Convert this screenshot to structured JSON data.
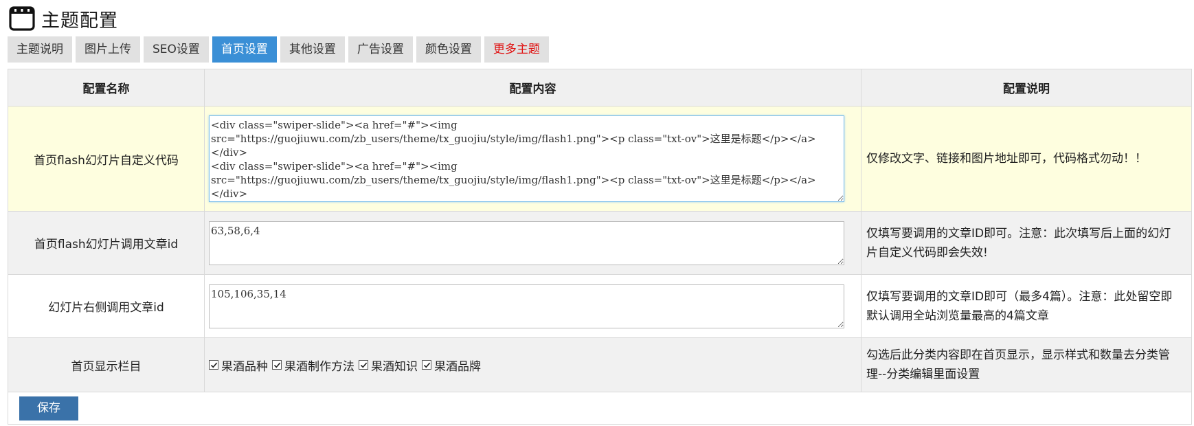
{
  "header": {
    "title": "主题配置",
    "icon": "app-window-icon"
  },
  "tabs": [
    {
      "label": "主题说明",
      "active": false,
      "highlight": false
    },
    {
      "label": "图片上传",
      "active": false,
      "highlight": false
    },
    {
      "label": "SEO设置",
      "active": false,
      "highlight": false
    },
    {
      "label": "首页设置",
      "active": true,
      "highlight": false
    },
    {
      "label": "其他设置",
      "active": false,
      "highlight": false
    },
    {
      "label": "广告设置",
      "active": false,
      "highlight": false
    },
    {
      "label": "颜色设置",
      "active": false,
      "highlight": false
    },
    {
      "label": "更多主题",
      "active": false,
      "highlight": true
    }
  ],
  "table": {
    "columns": [
      "配置名称",
      "配置内容",
      "配置说明"
    ],
    "rows": [
      {
        "name": "首页flash幻灯片自定义代码",
        "value": "<div class=\"swiper-slide\"><a href=\"#\"><img src=\"https://guojiuwu.com/zb_users/theme/tx_guojiu/style/img/flash1.png\"><p class=\"txt-ov\">这里是标题</p></a></div>\n<div class=\"swiper-slide\"><a href=\"#\"><img src=\"https://guojiuwu.com/zb_users/theme/tx_guojiu/style/img/flash1.png\"><p class=\"txt-ov\">这里是标题</p></a></div>",
        "desc": "仅修改文字、链接和图片地址即可，代码格式勿动！！"
      },
      {
        "name": "首页flash幻灯片调用文章id",
        "value": "63,58,6,4",
        "desc": "仅填写要调用的文章ID即可。注意：此次填写后上面的幻灯片自定义代码即会失效!"
      },
      {
        "name": "幻灯片右侧调用文章id",
        "value": "105,106,35,14",
        "desc": "仅填写要调用的文章ID即可（最多4篇）。注意：此处留空即默认调用全站浏览量最高的4篇文章"
      },
      {
        "name": "首页显示栏目",
        "checkboxes": [
          {
            "label": "果酒品种",
            "checked": true
          },
          {
            "label": "果酒制作方法",
            "checked": true
          },
          {
            "label": "果酒知识",
            "checked": true
          },
          {
            "label": "果酒品牌",
            "checked": true
          }
        ],
        "desc": "勾选后此分类内容即在首页显示，显示样式和数量去分类管理--分类编辑里面设置"
      }
    ]
  },
  "save_label": "保存",
  "colors": {
    "tab_active": "#3a8fd6",
    "tab_highlight_text": "#e01010",
    "save_button": "#3a72a9",
    "row_highlight": "#fefedf"
  }
}
